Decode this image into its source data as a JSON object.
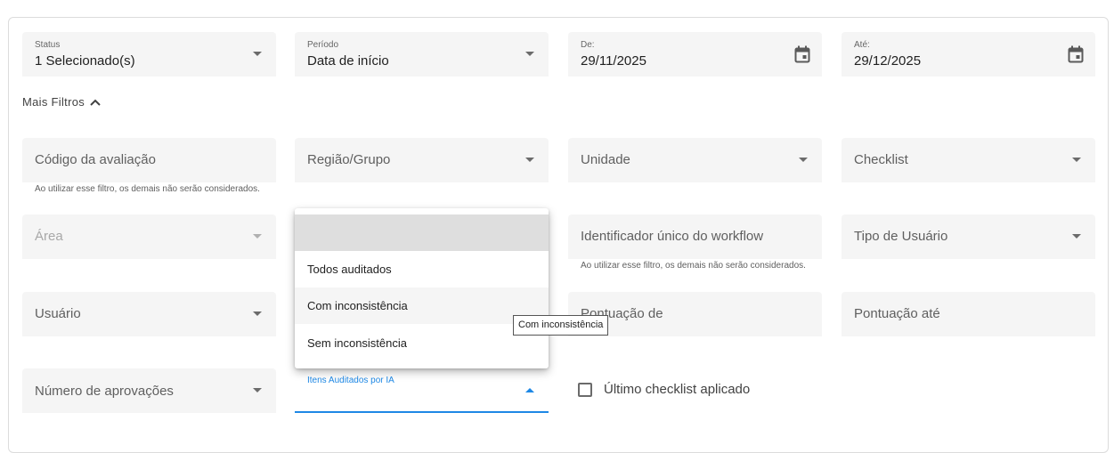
{
  "filters": {
    "status": {
      "label": "Status",
      "value": "1 Selecionado(s)"
    },
    "periodo": {
      "label": "Período",
      "value": "Data de início"
    },
    "de": {
      "label": "De:",
      "value": "29/11/2025"
    },
    "ate": {
      "label": "Até:",
      "value": "29/12/2025"
    }
  },
  "mais_filtros": {
    "label": "Mais Filtros",
    "icon": "chevron-up-icon"
  },
  "fields": {
    "codigo": {
      "placeholder": "Código da avaliação",
      "hint": "Ao utilizar esse filtro, os demais não serão considerados."
    },
    "regiao": {
      "placeholder": "Região/Grupo"
    },
    "unidade": {
      "placeholder": "Unidade"
    },
    "checklist": {
      "placeholder": "Checklist"
    },
    "area": {
      "placeholder": "Área"
    },
    "workflow": {
      "placeholder": "Identificador único do workflow",
      "hint": "Ao utilizar esse filtro, os demais não serão considerados."
    },
    "tipo_usuario": {
      "placeholder": "Tipo de Usuário"
    },
    "usuario": {
      "placeholder": "Usuário"
    },
    "pontuacao_de": {
      "placeholder": "Pontuação de"
    },
    "pontuacao_ate": {
      "placeholder": "Pontuação até"
    },
    "aprovacoes": {
      "placeholder": "Número de aprovações"
    },
    "itens_ia": {
      "label": "Itens Auditados por IA"
    }
  },
  "dropdown": {
    "options": [
      "",
      "Todos auditados",
      "Com inconsistência",
      "Sem inconsistência"
    ],
    "hovered": "Com inconsistência"
  },
  "tooltip": "Com inconsistência",
  "checkbox": {
    "label": "Último checklist aplicado",
    "checked": false
  },
  "colors": {
    "accent": "#1e88e5",
    "field_bg": "#f5f5f5",
    "menu_highlight": "#dedede",
    "menu_hover": "#f5f5f5"
  }
}
